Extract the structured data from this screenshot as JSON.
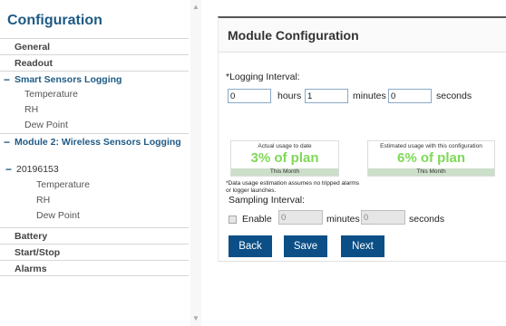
{
  "sidebar": {
    "title": "Configuration",
    "items": {
      "general": "General",
      "readout": "Readout",
      "smart_sensors": "Smart Sensors Logging",
      "temperature": "Temperature",
      "rh": "RH",
      "dew_point": "Dew Point",
      "module2": "Module 2: Wireless Sensors Logging",
      "device_id": "20196153",
      "temperature2": "Temperature",
      "rh2": "RH",
      "dew_point2": "Dew Point",
      "battery": "Battery",
      "start_stop": "Start/Stop",
      "alarms": "Alarms"
    }
  },
  "main": {
    "title": "Module Configuration",
    "logging_interval": {
      "label": "*Logging Interval:",
      "hours_value": "0",
      "hours_label": "hours",
      "minutes_value": "1",
      "minutes_label": "minutes",
      "seconds_value": "0",
      "seconds_label": "seconds"
    },
    "usage": {
      "actual": {
        "caption": "Actual usage to date",
        "value": "3% of plan",
        "period": "This Month"
      },
      "estimated": {
        "caption": "Estimated usage with this configuration",
        "value": "6% of plan",
        "period": "This Month"
      },
      "note": "*Data usage estimation assumes no tripped alarms or logger launches."
    },
    "sampling_interval": {
      "label": "Sampling Interval:",
      "enable_label": "Enable",
      "minutes_value": "0",
      "minutes_label": "minutes",
      "seconds_value": "0",
      "seconds_label": "seconds"
    },
    "buttons": {
      "back": "Back",
      "save": "Save",
      "next": "Next"
    }
  },
  "colors": {
    "brand": "#1e5a84",
    "button": "#0b4f86",
    "usage_green": "#7ed957"
  }
}
